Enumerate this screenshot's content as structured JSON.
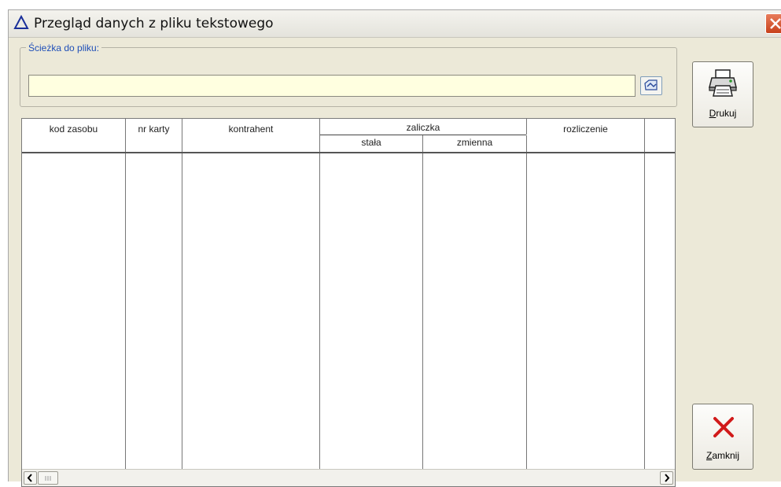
{
  "window": {
    "title": "Przegląd danych z pliku tekstowego"
  },
  "path": {
    "legend": "Ścieżka do pliku:",
    "value": "",
    "placeholder": ""
  },
  "table": {
    "headers": {
      "kod_zasobu": "kod zasobu",
      "nr_karty": "nr karty",
      "kontrahent": "kontrahent",
      "zaliczka": "zaliczka",
      "stala": "stała",
      "zmienna": "zmienna",
      "rozliczenie": "rozliczenie"
    },
    "rows": []
  },
  "buttons": {
    "print": {
      "accel": "D",
      "rest": "rukuj"
    },
    "close": {
      "accel": "Z",
      "rest": "amknij"
    }
  },
  "icons": [
    "warning-triangle-icon",
    "close-icon",
    "browse-folder-icon",
    "printer-icon",
    "red-x-icon",
    "scroll-left-icon",
    "scroll-right-icon"
  ]
}
